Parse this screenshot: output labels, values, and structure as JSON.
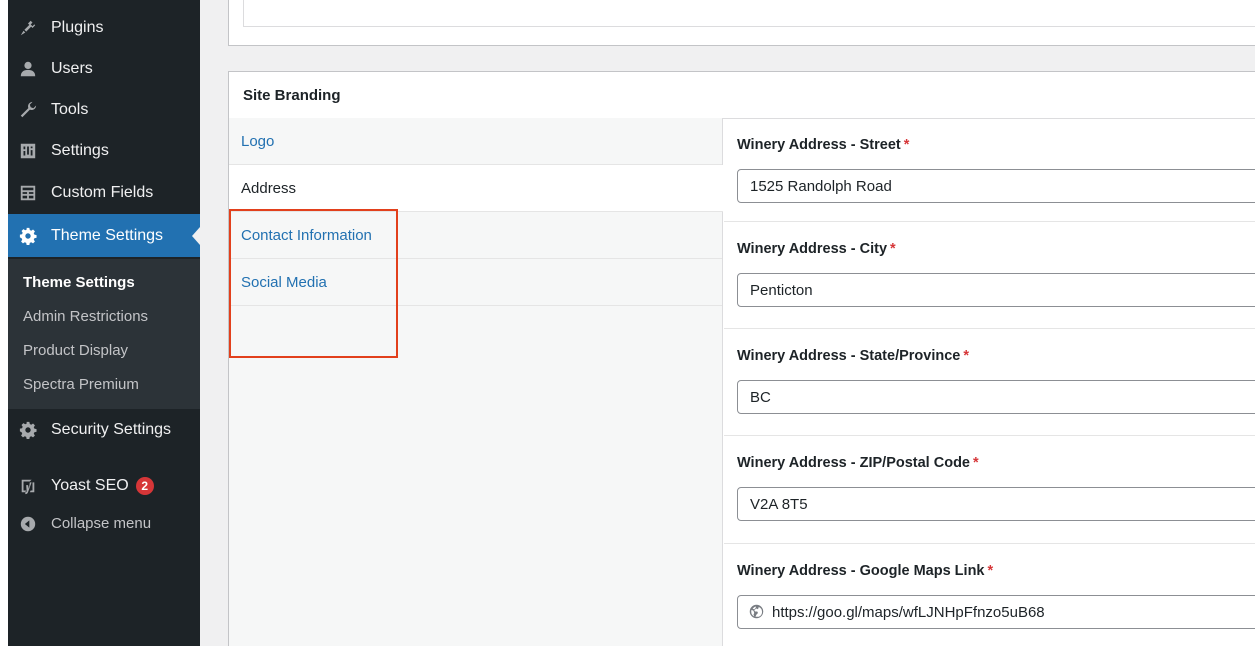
{
  "sidebar": {
    "menu": [
      {
        "label": "Plugins",
        "icon": "plugin-icon"
      },
      {
        "label": "Users",
        "icon": "users-icon"
      },
      {
        "label": "Tools",
        "icon": "wrench-icon"
      },
      {
        "label": "Settings",
        "icon": "settings-icon"
      },
      {
        "label": "Custom Fields",
        "icon": "custom-fields-icon"
      },
      {
        "label": "Theme Settings",
        "icon": "gear-icon"
      }
    ],
    "submenu": [
      "Theme Settings",
      "Admin Restrictions",
      "Product Display",
      "Spectra Premium"
    ],
    "security_label": "Security Settings",
    "yoast_label": "Yoast SEO",
    "yoast_badge": "2",
    "collapse_label": "Collapse menu"
  },
  "panel": {
    "title": "Site Branding",
    "tabs": [
      "Logo",
      "Address",
      "Contact Information",
      "Social Media"
    ],
    "active_tab": "Address"
  },
  "fields": {
    "street": {
      "label": "Winery Address - Street",
      "value": "1525 Randolph Road"
    },
    "city": {
      "label": "Winery Address - City",
      "value": "Penticton"
    },
    "state": {
      "label": "Winery Address - State/Province",
      "value": "BC"
    },
    "zip": {
      "label": "Winery Address - ZIP/Postal Code",
      "value": "V2A 8T5"
    },
    "maps": {
      "label": "Winery Address - Google Maps Link",
      "value": "https://goo.gl/maps/wfLJNHpFfnzo5uB68"
    },
    "required_mark": "*"
  },
  "colors": {
    "sidebar_bg": "#1d2327",
    "accent": "#2271b1",
    "required": "#d63638",
    "highlight_box": "#e2401c"
  }
}
